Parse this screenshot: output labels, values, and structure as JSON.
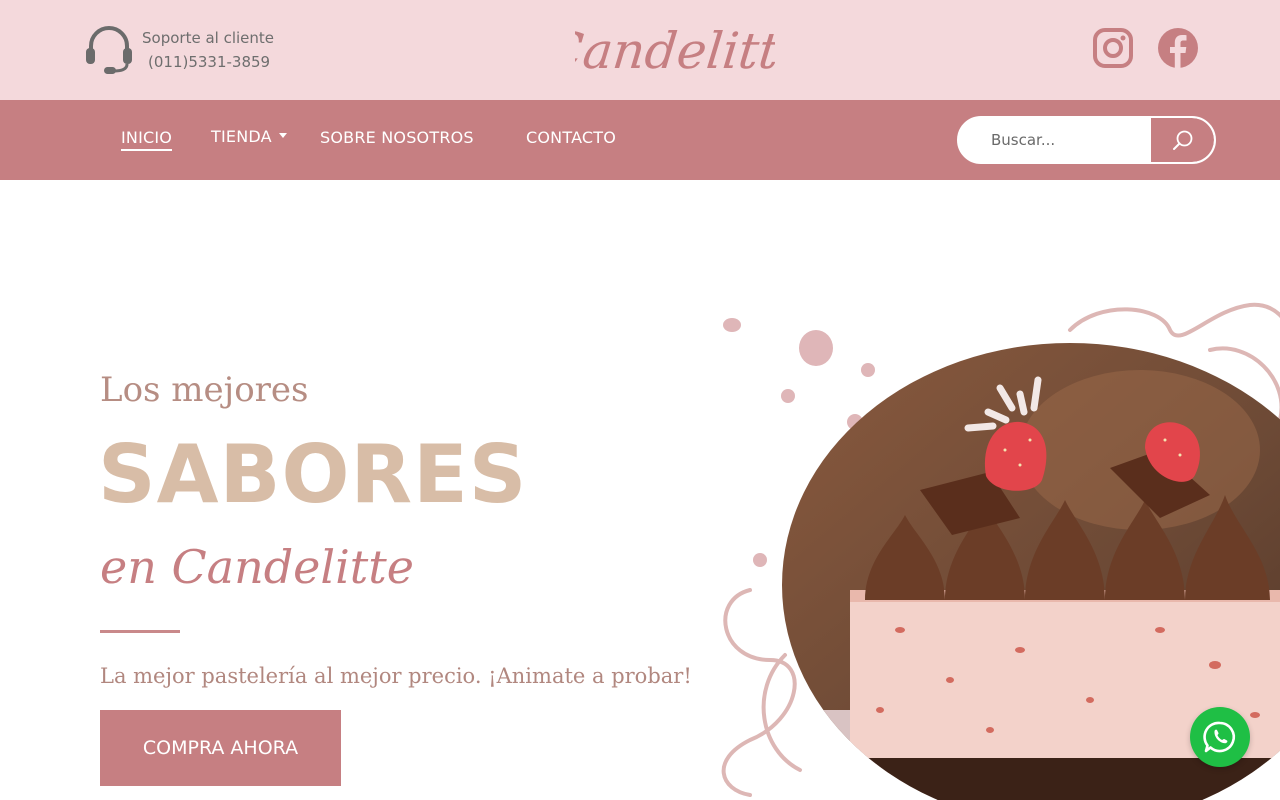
{
  "header": {
    "support_label": "Soporte al cliente",
    "support_phone": "(011)5331-3859",
    "logo_text": "Candelitte",
    "social": [
      "instagram-icon",
      "facebook-icon"
    ]
  },
  "nav": {
    "items": [
      {
        "label": "INICIO",
        "active": true
      },
      {
        "label": "TIENDA",
        "dropdown": true
      },
      {
        "label": "SOBRE NOSOTROS"
      },
      {
        "label": "CONTACTO"
      }
    ],
    "search": {
      "placeholder": "Buscar...",
      "button_icon": "search-icon"
    }
  },
  "hero": {
    "pretitle": "Los mejores",
    "title": "SABORES",
    "script": "en Candelitte",
    "subtitle": "La mejor pastelería al mejor precio. ¡Animate a probar!",
    "cta": "COMPRA AHORA"
  },
  "floating": {
    "whatsapp_icon": "whatsapp-icon"
  },
  "colors": {
    "topbar_bg": "#f4d9dc",
    "nav_bg": "#c67f82",
    "accent": "#c67f82",
    "title_beige": "#d8bda7",
    "whatsapp": "#1fbf45"
  }
}
